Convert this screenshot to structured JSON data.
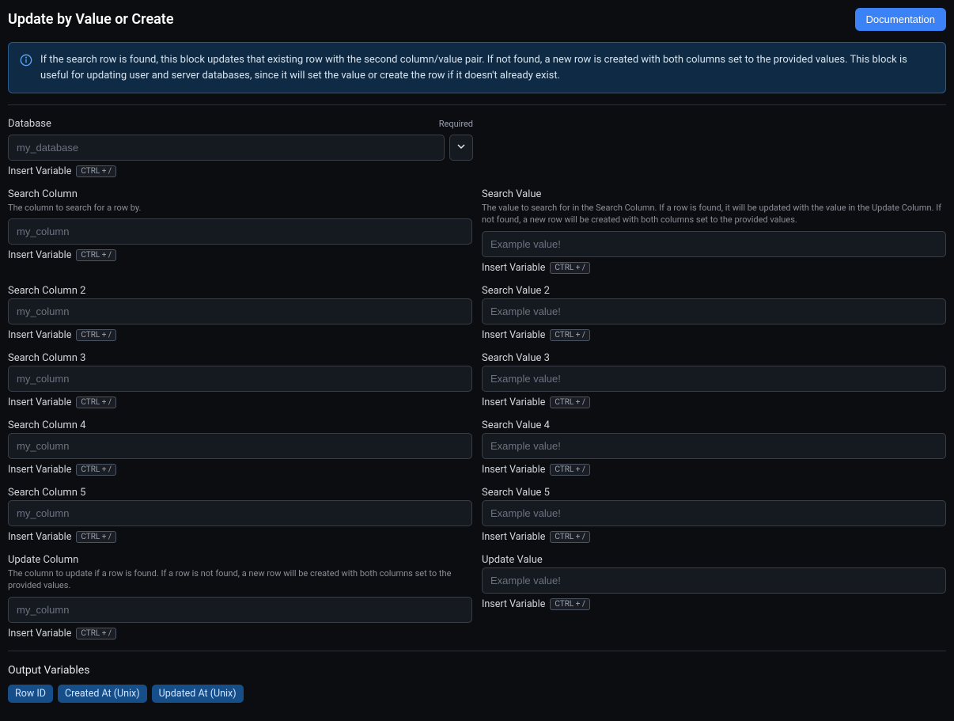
{
  "header": {
    "title": "Update by Value or Create",
    "doc_button": "Documentation"
  },
  "info_banner": "If the search row is found, this block updates that existing row with the second column/value pair. If not found, a new row is created with both columns set to the provided values. This block is useful for updating user and server databases, since it will set the value or create the row if it doesn't already exist.",
  "common": {
    "insert_variable": "Insert Variable",
    "kbd": "CTRL + /",
    "required": "Required"
  },
  "database": {
    "label": "Database",
    "placeholder": "my_database"
  },
  "search_column": {
    "label": "Search Column",
    "help": "The column to search for a row by.",
    "placeholder": "my_column"
  },
  "search_value": {
    "label": "Search Value",
    "help": "The value to search for in the Search Column. If a row is found, it will be updated with the value in the Update Column. If not found, a new row will be created with both columns set to the provided values.",
    "placeholder": "Example value!"
  },
  "search_column_2": {
    "label": "Search Column 2",
    "placeholder": "my_column"
  },
  "search_value_2": {
    "label": "Search Value 2",
    "placeholder": "Example value!"
  },
  "search_column_3": {
    "label": "Search Column 3",
    "placeholder": "my_column"
  },
  "search_value_3": {
    "label": "Search Value 3",
    "placeholder": "Example value!"
  },
  "search_column_4": {
    "label": "Search Column 4",
    "placeholder": "my_column"
  },
  "search_value_4": {
    "label": "Search Value 4",
    "placeholder": "Example value!"
  },
  "search_column_5": {
    "label": "Search Column 5",
    "placeholder": "my_column"
  },
  "search_value_5": {
    "label": "Search Value 5",
    "placeholder": "Example value!"
  },
  "update_column": {
    "label": "Update Column",
    "help": "The column to update if a row is found. If a row is not found, a new row will be created with both columns set to the provided values.",
    "placeholder": "my_column"
  },
  "update_value": {
    "label": "Update Value",
    "placeholder": "Example value!"
  },
  "output": {
    "title": "Output Variables",
    "chips": [
      "Row ID",
      "Created At (Unix)",
      "Updated At (Unix)"
    ]
  }
}
